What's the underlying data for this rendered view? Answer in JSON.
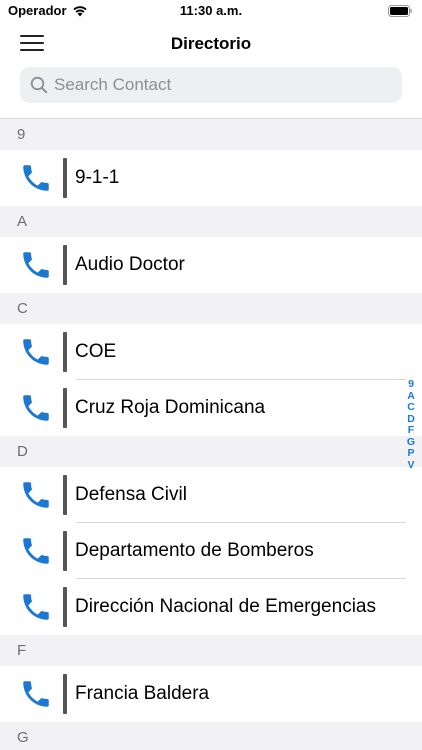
{
  "status": {
    "carrier": "Operador",
    "time": "11:30 a.m."
  },
  "nav": {
    "title": "Directorio"
  },
  "search": {
    "placeholder": "Search Contact"
  },
  "sections": [
    {
      "header": "9",
      "contacts": [
        "9-1-1"
      ]
    },
    {
      "header": "A",
      "contacts": [
        "Audio Doctor"
      ]
    },
    {
      "header": "C",
      "contacts": [
        "COE",
        "Cruz Roja Dominicana"
      ]
    },
    {
      "header": "D",
      "contacts": [
        "Defensa Civil",
        "Departamento de Bomberos",
        "Dirección Nacional de Emergencias"
      ]
    },
    {
      "header": "F",
      "contacts": [
        "Francia Baldera"
      ]
    },
    {
      "header": "G",
      "contacts": []
    }
  ],
  "index": [
    "9",
    "A",
    "C",
    "D",
    "F",
    "G",
    "P",
    "V"
  ],
  "colors": {
    "accent": "#1a7bd6",
    "phone": "#1e78d2",
    "bar": "#555555",
    "section_bg": "#f2f2f4"
  }
}
